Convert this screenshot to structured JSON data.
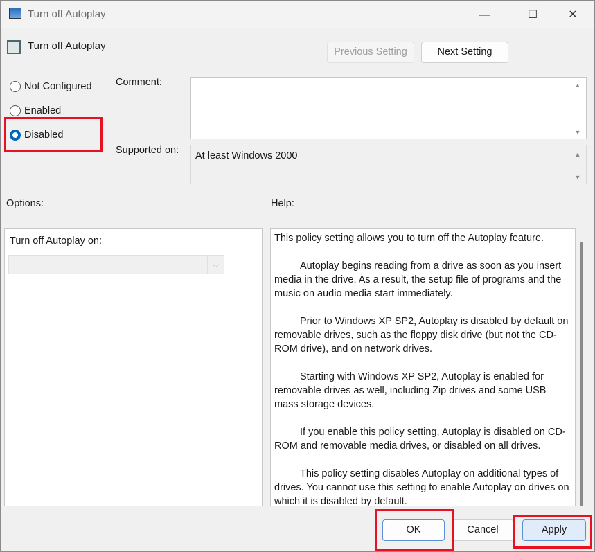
{
  "window": {
    "title": "Turn off Autoplay",
    "minimize": "—",
    "maximize": "☐",
    "close": "✕"
  },
  "header": {
    "policy_name": "Turn off Autoplay",
    "previous_label": "Previous Setting",
    "next_label": "Next Setting"
  },
  "state": {
    "options": [
      {
        "label": "Not Configured",
        "selected": false
      },
      {
        "label": "Enabled",
        "selected": false
      },
      {
        "label": "Disabled",
        "selected": true
      }
    ]
  },
  "comment": {
    "label": "Comment:",
    "value": ""
  },
  "supported": {
    "label": "Supported on:",
    "value": "At least Windows 2000"
  },
  "options_panel": {
    "label": "Options:",
    "field_label": "Turn off Autoplay on:",
    "select_value": ""
  },
  "help": {
    "label": "Help:",
    "paragraphs": [
      "This policy setting allows you to turn off the Autoplay feature.",
      "Autoplay begins reading from a drive as soon as you insert media in the drive. As a result, the setup file of programs and the music on audio media start immediately.",
      "Prior to Windows XP SP2, Autoplay is disabled by default on removable drives, such as the floppy disk drive (but not the CD-ROM drive), and on network drives.",
      "Starting with Windows XP SP2, Autoplay is enabled for removable drives as well, including Zip drives and some USB mass storage devices.",
      "If you enable this policy setting, Autoplay is disabled on CD-ROM and removable media drives, or disabled on all drives.",
      "This policy setting disables Autoplay on additional types of drives. You cannot use this setting to enable Autoplay on drives on which it is disabled by default."
    ]
  },
  "footer": {
    "ok_label": "OK",
    "cancel_label": "Cancel",
    "apply_label": "Apply"
  },
  "highlight_color": "#e81123",
  "accent_color": "#0067c0"
}
